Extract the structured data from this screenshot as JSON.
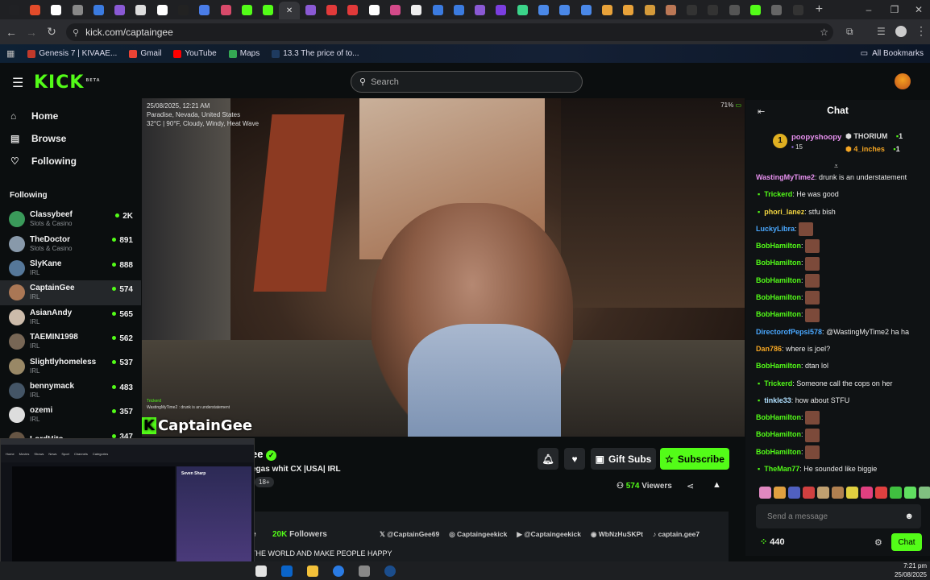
{
  "browser": {
    "url": "kick.com/captaingee",
    "tab_count": 38,
    "tab_close": "✕",
    "window_controls": [
      "–",
      "❐",
      "✕"
    ],
    "bookmarks": [
      {
        "label": "Genesis 7 | KIVAAE...",
        "color": "#c0392b"
      },
      {
        "label": "Gmail",
        "color": "#ea4335"
      },
      {
        "label": "YouTube",
        "color": "#ff0000"
      },
      {
        "label": "Maps",
        "color": "#34a853"
      },
      {
        "label": "13.3 The price of to...",
        "color": "#1e3a5f"
      }
    ],
    "all_bookmarks": "All Bookmarks"
  },
  "header": {
    "logo": "KICK",
    "logo_beta": "BETA",
    "search_placeholder": "Search"
  },
  "nav": [
    {
      "label": "Home",
      "icon": "⌂"
    },
    {
      "label": "Browse",
      "icon": "▤"
    },
    {
      "label": "Following",
      "icon": "♡"
    }
  ],
  "following": {
    "heading": "Following",
    "channels": [
      {
        "name": "Classybeef",
        "category": "Slots & Casino",
        "viewers": "2K",
        "color": "#3a9a5a"
      },
      {
        "name": "TheDoctor",
        "category": "Slots & Casino",
        "viewers": "891",
        "color": "#8899aa"
      },
      {
        "name": "SlyKane",
        "category": "IRL",
        "viewers": "888",
        "color": "#557799"
      },
      {
        "name": "CaptainGee",
        "category": "IRL",
        "viewers": "574",
        "color": "#aa7755"
      },
      {
        "name": "AsianAndy",
        "category": "IRL",
        "viewers": "565",
        "color": "#ccbbaa"
      },
      {
        "name": "TAEMIN1998",
        "category": "IRL",
        "viewers": "562",
        "color": "#776655"
      },
      {
        "name": "Slightlyhomeless",
        "category": "IRL",
        "viewers": "537",
        "color": "#998866"
      },
      {
        "name": "bennymack",
        "category": "IRL",
        "viewers": "483",
        "color": "#445566"
      },
      {
        "name": "ozemi",
        "category": "IRL",
        "viewers": "357",
        "color": "#dddddd"
      },
      {
        "name": "LordHito",
        "category": "",
        "viewers": "347",
        "color": "#665544"
      }
    ]
  },
  "video": {
    "timestamp": "25/08/2025, 12:21 AM",
    "location": "Paradise, Nevada, United States",
    "weather": "32°C | 90°F, Cloudy, Windy, Heat Wave",
    "battery": "71%",
    "overlay_brand": "CaptainGee",
    "overlay_chat_1": "Trickerd",
    "overlay_chat_2": "WastingMyTime2 : drunk is an understatement"
  },
  "stream": {
    "title_fragment": "egas whit CX  |USA| IRL",
    "name_fragment": "ee",
    "age_badge": "18+",
    "viewers": "574",
    "viewers_label": "Viewers",
    "followers": "20K",
    "followers_label": "Followers",
    "bio_fragment": "THE WORLD AND MAKE PEOPLE HAPPY",
    "gift_subs": "Gift Subs",
    "subscribe": "Subscribe",
    "socials": [
      {
        "icon": "𝕏",
        "label": "@CaptainGee69"
      },
      {
        "icon": "◎",
        "label": "Captaingeekick"
      },
      {
        "icon": "▶",
        "label": "@Captaingeekick"
      },
      {
        "icon": "◉",
        "label": "WbNzHuSKPt"
      },
      {
        "icon": "♪",
        "label": "captain.gee7"
      }
    ]
  },
  "pip": {
    "nav": [
      "Home",
      "Movies",
      "Shows",
      "News",
      "Sport",
      "Channels",
      "Categories"
    ],
    "title": "Seven Sharp"
  },
  "chat": {
    "title": "Chat",
    "leaderboard": {
      "rank": "1",
      "user": "poopyshoopy",
      "user_score": "15",
      "entries": [
        {
          "name": "THORIUM",
          "score": "1"
        },
        {
          "name": "4_inches",
          "score": "1"
        }
      ]
    },
    "messages": [
      {
        "user": "WastingMyTime2",
        "text": "drunk is an understatement",
        "color": "#e891f0",
        "indent": false,
        "emotes": 0
      },
      {
        "user": "Trickerd",
        "text": "He was good",
        "color": "#53fc18",
        "indent": true,
        "emotes": 0
      },
      {
        "user": "phori_lanez",
        "text": "stfu bish",
        "color": "#f5d742",
        "indent": true,
        "emotes": 0
      },
      {
        "user": "LuckyLibra",
        "text": "",
        "color": "#4aa8ff",
        "indent": false,
        "emotes": 1
      },
      {
        "user": "BobHamilton",
        "text": "",
        "color": "#53fc18",
        "indent": false,
        "emotes": 1
      },
      {
        "user": "BobHamilton",
        "text": "",
        "color": "#53fc18",
        "indent": false,
        "emotes": 1
      },
      {
        "user": "BobHamilton",
        "text": "",
        "color": "#53fc18",
        "indent": false,
        "emotes": 1
      },
      {
        "user": "BobHamilton",
        "text": "",
        "color": "#53fc18",
        "indent": false,
        "emotes": 1
      },
      {
        "user": "BobHamilton",
        "text": "",
        "color": "#53fc18",
        "indent": false,
        "emotes": 1
      },
      {
        "user": "DirectorofPepsi578",
        "text": "@WastingMyTime2 ha ha",
        "color": "#4aa8ff",
        "indent": false,
        "emotes": 0
      },
      {
        "user": "Dan786",
        "text": "where is joel?",
        "color": "#f5a623",
        "indent": false,
        "emotes": 0
      },
      {
        "user": "BobHamilton",
        "text": "dtan lol",
        "color": "#53fc18",
        "indent": false,
        "emotes": 0
      },
      {
        "user": "Trickerd",
        "text": "Someone call the cops on her",
        "color": "#53fc18",
        "indent": true,
        "emotes": 0
      },
      {
        "user": "tinkle33",
        "text": "how about STFU",
        "color": "#b0e0ff",
        "indent": true,
        "emotes": 0
      },
      {
        "user": "BobHamilton",
        "text": "",
        "color": "#53fc18",
        "indent": false,
        "emotes": 1
      },
      {
        "user": "BobHamilton",
        "text": "",
        "color": "#53fc18",
        "indent": false,
        "emotes": 1
      },
      {
        "user": "BobHamilton",
        "text": "",
        "color": "#53fc18",
        "indent": false,
        "emotes": 1
      },
      {
        "user": "TheMan77",
        "text": "He sounded like biggie",
        "color": "#53fc18",
        "indent": true,
        "emotes": 0
      }
    ],
    "input_placeholder": "Send a message",
    "points": "440",
    "chat_button": "Chat"
  },
  "taskbar": {
    "time": "7:21 pm",
    "date": "25/08/2025"
  }
}
